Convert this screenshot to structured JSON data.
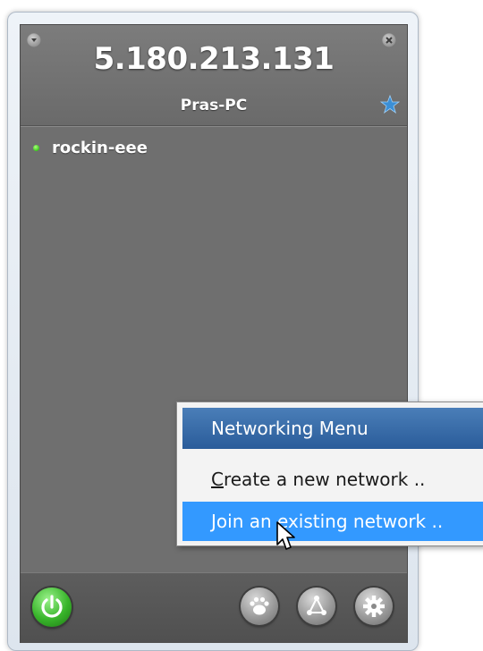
{
  "header": {
    "ip_address": "5.180.213.131",
    "hostname": "Pras-PC"
  },
  "networks": [
    {
      "name": "rockin-eee",
      "status": "online",
      "status_color": "#3cc81e"
    }
  ],
  "menu": {
    "title": "Networking Menu",
    "items": [
      {
        "accel": "C",
        "rest": "reate a new network ..",
        "highlighted": false
      },
      {
        "accel": "J",
        "rest": "oin an existing network ..",
        "highlighted": true
      }
    ]
  },
  "toolbar": {
    "buttons": [
      "power-icon",
      "paw-icon",
      "network-icon",
      "gear-icon"
    ]
  },
  "colors": {
    "panel": "#6f6f6f",
    "menu_title": "#2a5c9a",
    "menu_highlight": "#3399ff",
    "power": "#39b52b",
    "star": "#3b8fd6"
  }
}
